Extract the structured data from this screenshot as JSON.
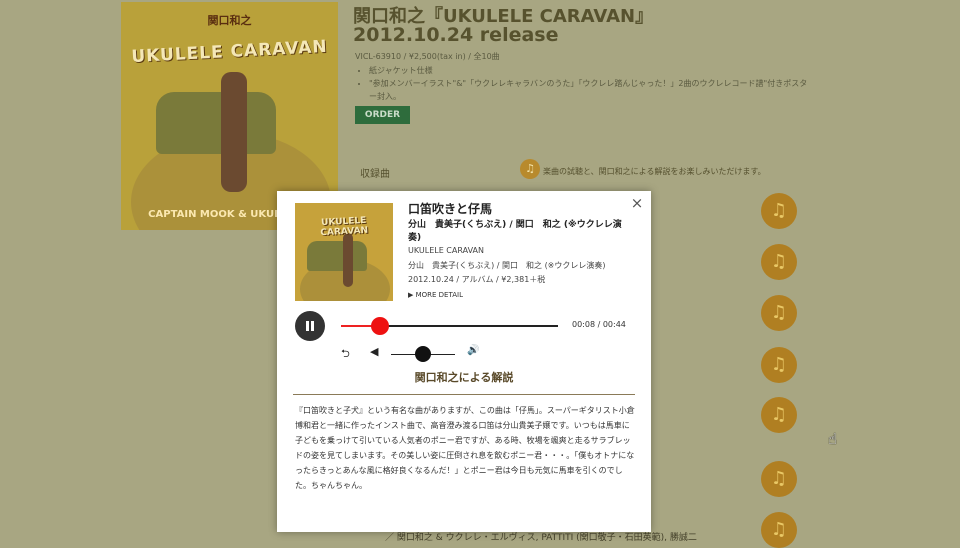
{
  "page": {
    "title": "関口和之『UKULELE CARAVAN』",
    "release": "2012.10.24 release",
    "catalog": "VICL-63910 / ¥2,500(tax in) / 全10曲",
    "bullets": [
      "紙ジャケット仕様",
      "\"参加メンバーイラスト\"&\"「ウクレレキャラバンのうた」「ウクレレ踏んじゃった！」2曲のウクレレコード譜\"付きポスター封入。"
    ],
    "order_label": "ORDER",
    "tracks_label": "収録曲",
    "tracks_desc": "楽曲の試聴と、関口和之による解説をお楽しみいただけます。",
    "footer_fragment": "／ 関口和之 & ウクレレ・エルヴィス, PATTITI (関口敬子・石田英範), 勝誠二",
    "note_glyph": "♫"
  },
  "cover": {
    "top_text": "関口和之",
    "title": "UKULELE CARAVAN",
    "bottom_text": "CAPTAIN MOOK & UKULELE E"
  },
  "modal": {
    "close_glyph": "×",
    "thumb_title": "UKULELE CARAVAN",
    "song_title": "口笛吹きと仔馬",
    "artist": "分山　貴美子(くちぶえ) / 関口　和之 (※ウクレレ演奏)",
    "album": "UKULELE CARAVAN",
    "artist_sub": "分山　貴美子(くちぶえ) / 関口　和之 (※ウクレレ演奏)",
    "release_info": "2012.10.24 / アルバム / ¥2,381＋税",
    "more_detail": "▶ MORE DETAIL",
    "player": {
      "progress_fraction": 0.18,
      "volume_fraction": 0.5,
      "time_display": "00:08 / 00:44",
      "repeat_glyph": "⮌",
      "mute_glyph": "◀",
      "volume_glyph": "🔊"
    },
    "commentary_heading": "関口和之による解説",
    "commentary": "『口笛吹きと子犬』という有名な曲がありますが、この曲は「仔馬」。スーパーギタリスト小倉博和君と一緒に作ったインスト曲で、高音澄み渡る口笛は分山貴美子嬢です。いつもは馬車に子どもを乗っけて引いている人気者のポニー君ですが、ある時、牧場を颯爽と走るサラブレッドの姿を見てしまいます。その美しい姿に圧倒され息を飲むポニー君・・・。「僕もオトナになったらきっとあんな風に格好良くなるんだ！」とポニー君は今日も元気に馬車を引くのでした。ちゃんちゃん。"
  }
}
